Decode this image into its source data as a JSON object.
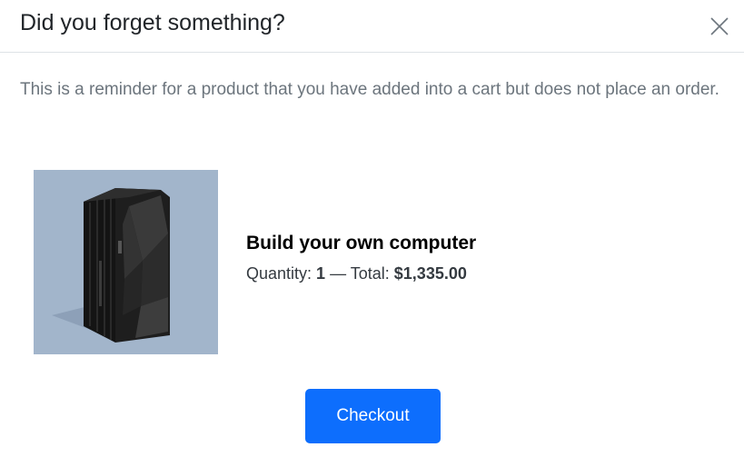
{
  "modal": {
    "title": "Did you forget something?",
    "close_icon": "close-icon",
    "reminder_text": "This is a reminder for a product that you have added into a cart but does not place an order."
  },
  "product": {
    "image_icon": "server-computer-image",
    "name": "Build your own computer",
    "quantity_label": "Quantity: ",
    "quantity": "1",
    "separator": " — ",
    "total_label": "Total: ",
    "total": "$1,335.00"
  },
  "actions": {
    "checkout_label": "Checkout"
  },
  "colors": {
    "accent": "#0d6efd",
    "image_background": "#a2b5cb",
    "muted_text": "#6c757d"
  }
}
